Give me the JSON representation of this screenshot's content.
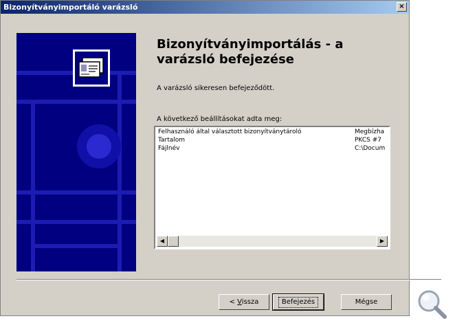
{
  "window": {
    "title": "Bizonyítványimportáló varázsló",
    "close_glyph": "×"
  },
  "content": {
    "heading_line1": "Bizonyítványimportálás - a",
    "heading_line2": "varázsló befejezése",
    "message": "A varázsló sikeresen befejeződött.",
    "settings_label": "A következő beállításokat adta meg:",
    "rows": [
      {
        "key": "Felhasználó által választott bizonyítványtároló",
        "value": "Megbízha"
      },
      {
        "key": "Tartalom",
        "value": "PKCS #7"
      },
      {
        "key": "Fájlnév",
        "value": "C:\\Docum"
      }
    ],
    "scroll_left_glyph": "◀",
    "scroll_right_glyph": "▶"
  },
  "buttons": {
    "back_prefix": "< ",
    "back_mnemonic": "V",
    "back_rest": "issza",
    "finish": "Befejezés",
    "cancel": "Mégse"
  },
  "icons": {
    "banner": "certificate-icon",
    "zoom": "magnifier-icon"
  },
  "colors": {
    "title_start": "#0a246a",
    "title_end": "#a6caf0",
    "banner": "#000080",
    "dialog": "#d4d0c8"
  }
}
